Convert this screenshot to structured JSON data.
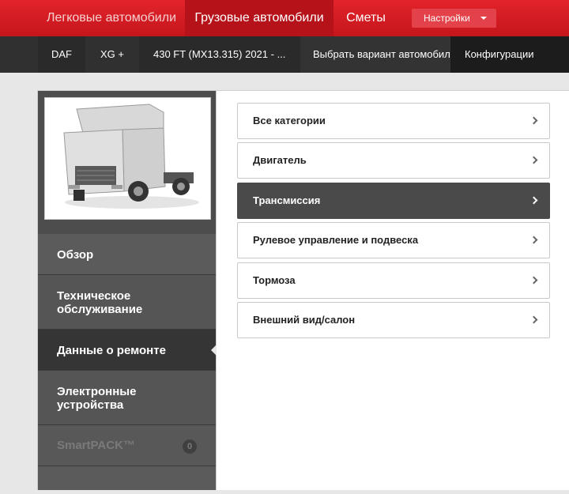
{
  "topnav": {
    "tabs": [
      "Легковые автомобили",
      "Грузовые автомобили",
      "Сметы"
    ],
    "settings_label": "Настройки"
  },
  "breadcrumb": [
    "DAF",
    "XG +",
    "430 FT (MX13.315) 2021 - ...",
    "Выбрать вариант автомобиля",
    "Конфигурации"
  ],
  "left_menu": {
    "items": [
      {
        "label": "Обзор"
      },
      {
        "label": "Техническое обслуживание"
      },
      {
        "label": "Данные о ремонте"
      },
      {
        "label": "Электронные устройства"
      },
      {
        "label": "SmartPACK™",
        "badge": "0"
      }
    ]
  },
  "categories": [
    {
      "label": "Все категории"
    },
    {
      "label": "Двигатель"
    },
    {
      "label": "Трансмиссия"
    },
    {
      "label": "Рулевое управление и подвеска"
    },
    {
      "label": "Тормоза"
    },
    {
      "label": "Внешний вид/салон"
    }
  ],
  "colors": {
    "brand_red": "#d71f26",
    "dark_bar": "#303030",
    "active_item": "#353535"
  }
}
